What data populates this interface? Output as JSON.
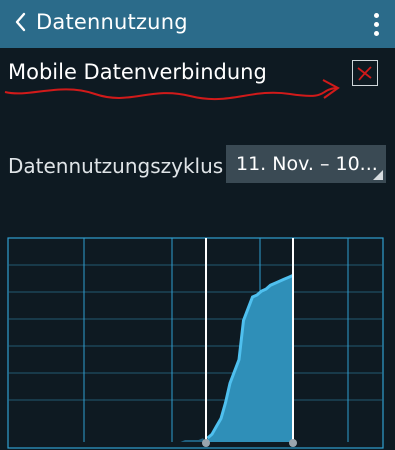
{
  "header": {
    "title": "Datennutzung",
    "back_icon": "chevron-left-icon",
    "menu_icon": "overflow-menu-icon"
  },
  "mobile_data": {
    "label": "Mobile Datenverbindung",
    "enabled": false
  },
  "cycle": {
    "label": "Datennutzungszyklus",
    "value": "11. Nov. – 10..."
  },
  "colors": {
    "app_bar": "#2b6b8a",
    "background": "#0e1a22",
    "usage_fill": "#2f8fb8",
    "usage_line": "#4fc0ef",
    "annotation": "#d11a1a"
  },
  "usage_graph": {
    "cumulative_usage": [
      0,
      0,
      0,
      0,
      0,
      0,
      0,
      0,
      0,
      0,
      0.01,
      0.01,
      0.01,
      0.01,
      0.02,
      0.02,
      0.04,
      0.08,
      0.12,
      0.2,
      0.3,
      0.36,
      0.42,
      0.62,
      0.68,
      0.74,
      0.75,
      0.77,
      0.78,
      0.8,
      0.81,
      0.82,
      0.83,
      0.84,
      0.85
    ]
  }
}
